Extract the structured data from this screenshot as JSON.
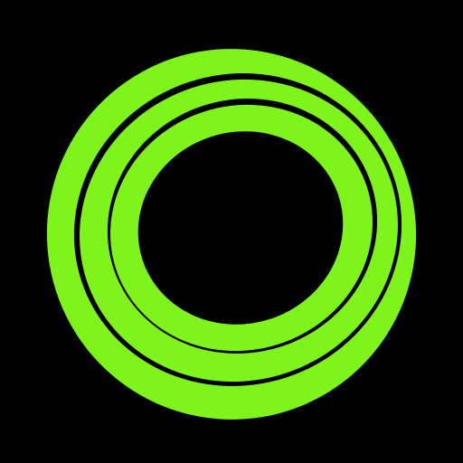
{
  "icon": {
    "name": "concentric-rings-logo-icon",
    "background_color": "#000000",
    "ring_color": "#7DF51A",
    "ring_gap_color": "#000000",
    "ring_count": 3
  }
}
